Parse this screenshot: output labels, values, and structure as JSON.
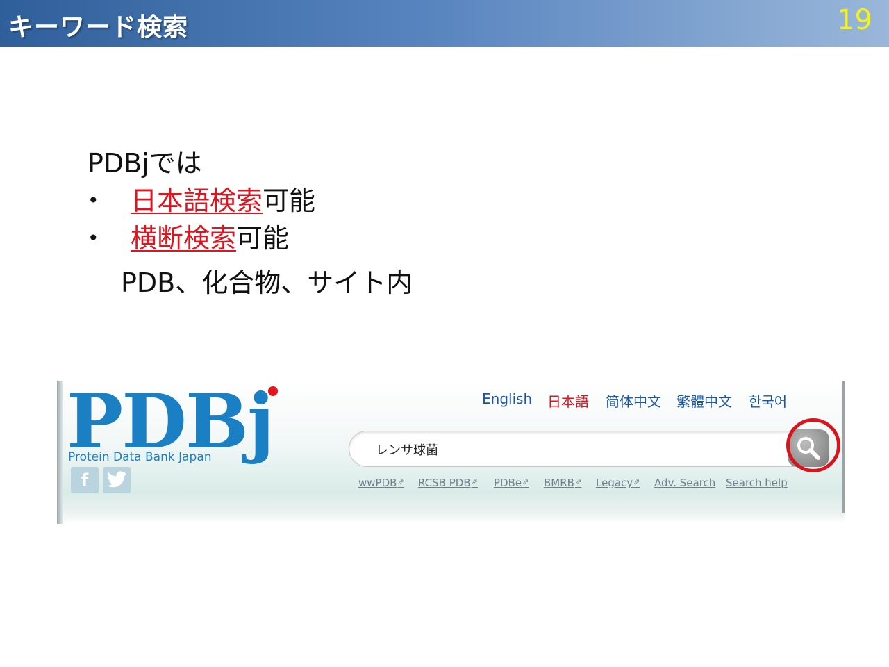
{
  "slide": {
    "title": "キーワード検索",
    "number": "19",
    "intro": "PDBjでは",
    "bullets": [
      {
        "marker": "•",
        "highlight": "日本語検索",
        "rest": "可能"
      },
      {
        "marker": "•",
        "highlight": "横断検索",
        "rest": "可能"
      }
    ],
    "sub_note": "PDB、化合物、サイト内"
  },
  "pdbj": {
    "logo_text": "PDBj",
    "logo_subtitle": "Protein Data Bank Japan",
    "social": [
      {
        "label": "f",
        "icon": "facebook-icon"
      },
      {
        "label": "🐦",
        "icon": "twitter-icon"
      }
    ],
    "languages": [
      "English",
      "日本語",
      "简体中文",
      "繁體中文",
      "한국어"
    ],
    "active_language": "日本語",
    "search": {
      "value": "レンサ球菌",
      "button_icon": "magnifier-icon"
    },
    "links": [
      "wwPDB",
      "RCSB PDB",
      "PDBe",
      "BMRB",
      "Legacy",
      "Adv. Search",
      "Search help"
    ],
    "ext_icon": "⇗"
  },
  "colors": {
    "title_bar_start": "#2f5f9a",
    "title_bar_end": "#9ab7da",
    "slide_number": "#f3f21a",
    "highlight_red": "#e0141e",
    "logo_blue": "#1b7fc4",
    "lang_blue": "#1a55a8",
    "ring_red": "#d9141c"
  }
}
